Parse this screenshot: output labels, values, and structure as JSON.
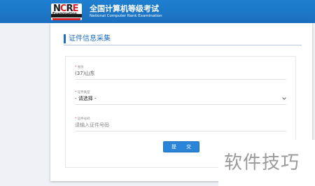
{
  "header": {
    "logo_top": "NCRE",
    "logo_word": "Examination",
    "title_cn": "全国计算机等级考试",
    "title_en": "National Computer Rank Examination"
  },
  "section": {
    "title": "证件信息采集"
  },
  "form": {
    "province": {
      "label": "省份",
      "required_mark": "*",
      "value": "(37)山东"
    },
    "id_type": {
      "label": "证件类型",
      "required_mark": "*",
      "value": "- 请选择 -"
    },
    "id_number": {
      "label": "证件号码",
      "required_mark": "*",
      "placeholder": "请输入证件号码"
    },
    "submit_label": "提 交"
  },
  "watermark": "软件技巧",
  "colors": {
    "header_blue": "#1f7fd0",
    "accent": "#1f6fc0",
    "button": "#2a85d8",
    "required": "#d0301f"
  }
}
